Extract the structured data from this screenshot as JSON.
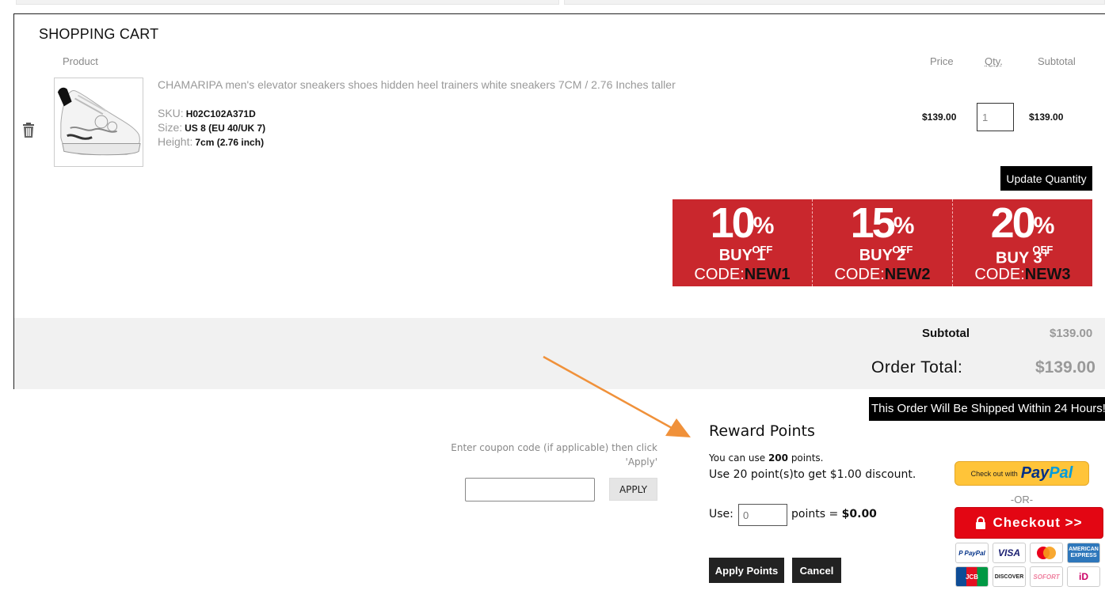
{
  "cart": {
    "title": "SHOPPING CART",
    "columns": {
      "product": "Product",
      "price": "Price",
      "qty": "Qty.",
      "subtotal": "Subtotal"
    },
    "item": {
      "name": "CHAMARIPA men's elevator sneakers shoes hidden heel trainers white sneakers 7CM / 2.76 Inches taller",
      "sku_label": "SKU:",
      "sku": "H02C102A371D",
      "size_label": "Size:",
      "size": "US 8 (EU 40/UK 7)",
      "height_label": "Height:",
      "height": "7cm (2.76 inch)",
      "price": "$139.00",
      "qty": "1",
      "subtotal": "$139.00"
    },
    "update_label": "Update Quantity"
  },
  "promo": [
    {
      "pct": "10",
      "buy": "BUY 1",
      "code_label": "CODE:",
      "code": "NEW1",
      "plus": ""
    },
    {
      "pct": "15",
      "buy": "BUY 2",
      "code_label": "CODE:",
      "code": "NEW2",
      "plus": ""
    },
    {
      "pct": "20",
      "buy": "BUY 3",
      "code_label": "CODE:",
      "code": "NEW3",
      "plus": "+"
    }
  ],
  "promo_common": {
    "percent_sign": "%",
    "off": "OFF"
  },
  "totals": {
    "subtotal_label": "Subtotal",
    "subtotal": "$139.00",
    "order_label": "Order Total:",
    "order": "$139.00"
  },
  "ship_banner": "This Order Will Be Shipped Within 24 Hours!",
  "coupon": {
    "hint": "Enter coupon code (if applicable) then click 'Apply'",
    "apply_label": "APPLY",
    "value": ""
  },
  "reward": {
    "title": "Reward Points",
    "line1_pre": "You can use ",
    "line1_points": "200",
    "line1_post": " points.",
    "line2": "Use 20 point(s)to get $1.00 discount.",
    "use_label": "Use:",
    "use_value": "0",
    "eq_pre": "points = ",
    "eq_value": "$0.00",
    "apply_label": "Apply Points",
    "cancel_label": "Cancel"
  },
  "payment": {
    "paypal_small": "Check out with",
    "paypal_pay": "Pay",
    "paypal_pal": "Pal",
    "or": "-OR-",
    "checkout_label": "Checkout >>",
    "cards": [
      "P PayPal",
      "VISA",
      "MasterCard",
      "AMERICAN EXPRESS",
      "JCB",
      "DISCOVER",
      "SOFORT",
      "iD"
    ]
  },
  "colors": {
    "promo_red": "#c9272d",
    "checkout_red": "#e30613",
    "paypal_yellow": "#ffc439",
    "arrow_orange": "#f0913a"
  }
}
